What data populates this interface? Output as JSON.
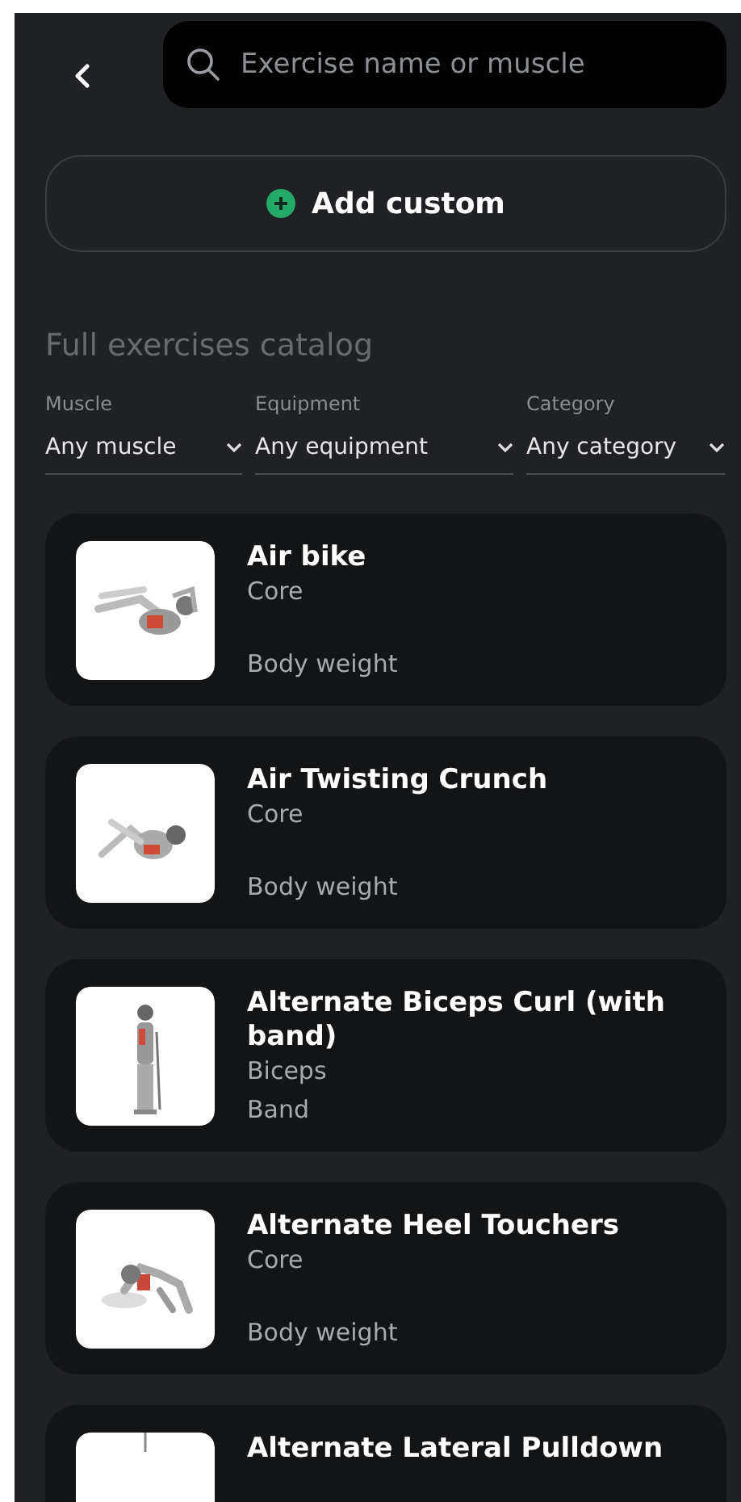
{
  "search": {
    "placeholder": "Exercise name or muscle"
  },
  "add_button": {
    "label": "Add custom"
  },
  "catalog_title": "Full exercises catalog",
  "filters": [
    {
      "label": "Muscle",
      "value": "Any muscle"
    },
    {
      "label": "Equipment",
      "value": "Any equipment"
    },
    {
      "label": "Category",
      "value": "Any category"
    }
  ],
  "exercises": [
    {
      "name": "Air bike",
      "muscle": "Core",
      "equipment": "Body weight"
    },
    {
      "name": "Air Twisting Crunch",
      "muscle": "Core",
      "equipment": "Body weight"
    },
    {
      "name": "Alternate Biceps Curl (with band)",
      "muscle": "Biceps",
      "equipment": "Band"
    },
    {
      "name": "Alternate Heel Touchers",
      "muscle": "Core",
      "equipment": "Body weight"
    },
    {
      "name": "Alternate Lateral Pulldown"
    }
  ]
}
